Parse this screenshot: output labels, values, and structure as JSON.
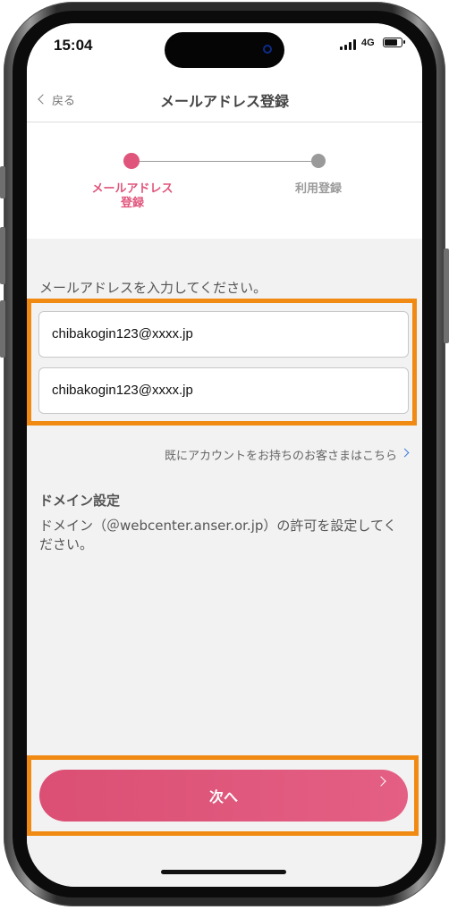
{
  "status_bar": {
    "time": "15:04",
    "network": "4G",
    "battery_level": 0.85
  },
  "nav": {
    "back_label": "戻る",
    "title": "メールアドレス登録"
  },
  "stepper": {
    "steps": [
      {
        "label": "メールアドレス\n登録",
        "active": true
      },
      {
        "label": "利用登録",
        "active": false
      }
    ],
    "active_color": "#e0557b",
    "inactive_color": "#9a9a9a"
  },
  "form": {
    "instruction": "メールアドレスを入力してください。",
    "email_value": "chibakogin123@xxxx.jp",
    "email_confirm_value": "chibakogin123@xxxx.jp"
  },
  "account_link": "既にアカウントをお持ちのお客さまはこちら",
  "domain": {
    "heading": "ドメイン設定",
    "text": "ドメイン（＠webcenter.anser.or.jp）の許可を設定してください。"
  },
  "next_button": {
    "label": "次へ",
    "color": "#e0557b"
  },
  "highlight_color": "#f08a12",
  "icons": [
    "back-chevron-icon",
    "link-chevron-icon",
    "next-chevron-icon",
    "signal-icon",
    "battery-icon"
  ]
}
